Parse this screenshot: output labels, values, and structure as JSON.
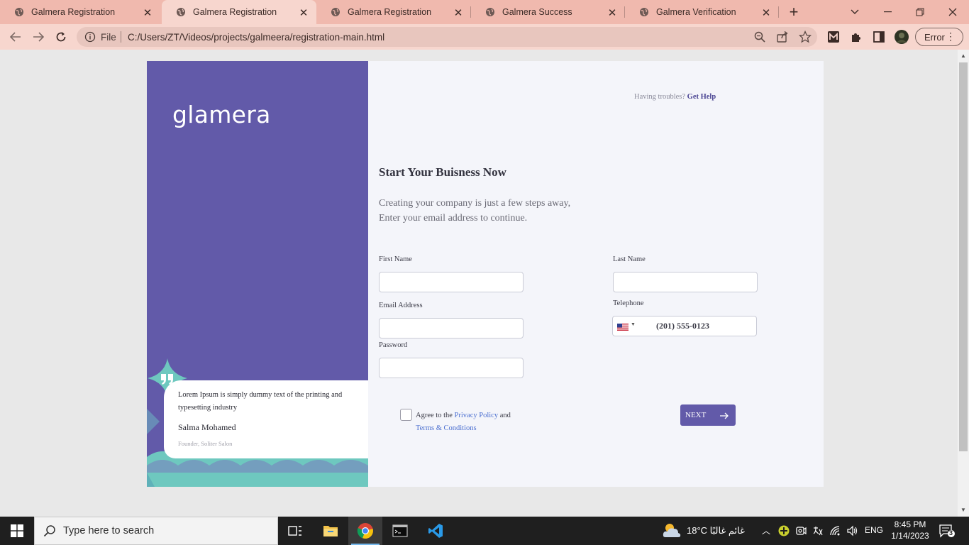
{
  "browser": {
    "tabs": [
      {
        "title": "Galmera Registration",
        "active": false
      },
      {
        "title": "Galmera Registration",
        "active": true
      },
      {
        "title": "Galmera Registration",
        "active": false
      },
      {
        "title": "Galmera Success",
        "active": false
      },
      {
        "title": "Galmera Verification",
        "active": false
      }
    ],
    "close_glyph": "✕",
    "new_tab_glyph": "+",
    "address": {
      "scheme_label": "File",
      "url": "C:/Users/ZT/Videos/projects/galmeera/registration-main.html"
    },
    "profile_error_label": "Error",
    "colors": {
      "tab_strip": "#f0b9ae",
      "toolbar": "#f7d6ce"
    }
  },
  "page": {
    "brand": {
      "logo_text": "glamera",
      "color": "#625aa9",
      "accent": "#6ec8bf"
    },
    "help": {
      "prompt": "Having troubles?",
      "link": "Get Help"
    },
    "title": "Start Your Buisness Now",
    "subtitle_line1": "Creating your company is just a few steps away,",
    "subtitle_line2": "Enter your email address to continue.",
    "form": {
      "first_name_label": "First Name",
      "first_name_value": "",
      "last_name_label": "Last Name",
      "last_name_value": "",
      "email_label": "Email Address",
      "email_value": "",
      "telephone_label": "Telephone",
      "telephone_value": "(201) 555-0123",
      "telephone_country": "us-flag-icon",
      "password_label": "Password",
      "password_value": ""
    },
    "agree": {
      "prefix": "Agree to the",
      "privacy_link": "Privacy Policy",
      "and": "and",
      "terms_link": "Terms & Conditions",
      "checked": false
    },
    "next_button": "NEXT",
    "testimonial": {
      "quote": "Lorem Ipsum is simply dummy text of the printing and typesetting industry",
      "name": "Salma Mohamed",
      "role": "Founder, Soliter Salon"
    }
  },
  "taskbar": {
    "search_placeholder": "Type here to search",
    "weather": "18°C  غائم غالبًا",
    "language": "ENG",
    "time": "8:45 PM",
    "date": "1/14/2023",
    "notification_count": "3"
  }
}
